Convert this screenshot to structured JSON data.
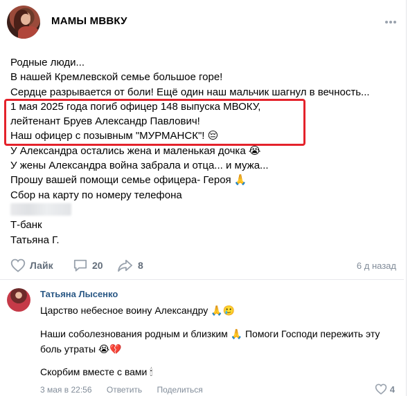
{
  "post": {
    "group_name": "МАМЫ МВВКУ",
    "lines": [
      "Родные люди...",
      "В нашей Кремлевской семье большое горе!",
      "Сердце разрывается от боли! Ещё один наш мальчик шагнул в вечность...",
      "1 мая 2025 года погиб офицер 148 выпуска МВОКУ,",
      "лейтенант Бруев Александр Павлович!",
      "Наш офицер с позывным \"МУРМАНСК\"! 😔",
      "У Александра остались жена и маленькая дочка 😭",
      "У жены Александра война забрала и отца... и мужа...",
      "Прошу вашей помощи семье офицера- Героя 🙏",
      "Сбор на карту по номеру телефона",
      "Т-банк",
      "Татьяна Г."
    ],
    "highlight_color": "#e4222b"
  },
  "actions": {
    "like_label": "Лайк",
    "comments_count": "20",
    "shares_count": "8",
    "time": "6 д назад"
  },
  "comment": {
    "author": "Татьяна Лысенко",
    "lines": [
      "Царство небесное воину Александру 🙏🥲",
      "Наши соболезнования родным и близким 🙏 Помоги Господи пережить эту",
      "боль утраты 😭💔",
      "Скорбим вместе с вами 🕯"
    ],
    "date": "3 мая в 22:56",
    "reply_label": "Ответить",
    "share_label": "Поделиться",
    "likes": "4"
  },
  "colors": {
    "accent": "#2a5885",
    "muted": "#818c99",
    "icon": "#99a2ad"
  }
}
